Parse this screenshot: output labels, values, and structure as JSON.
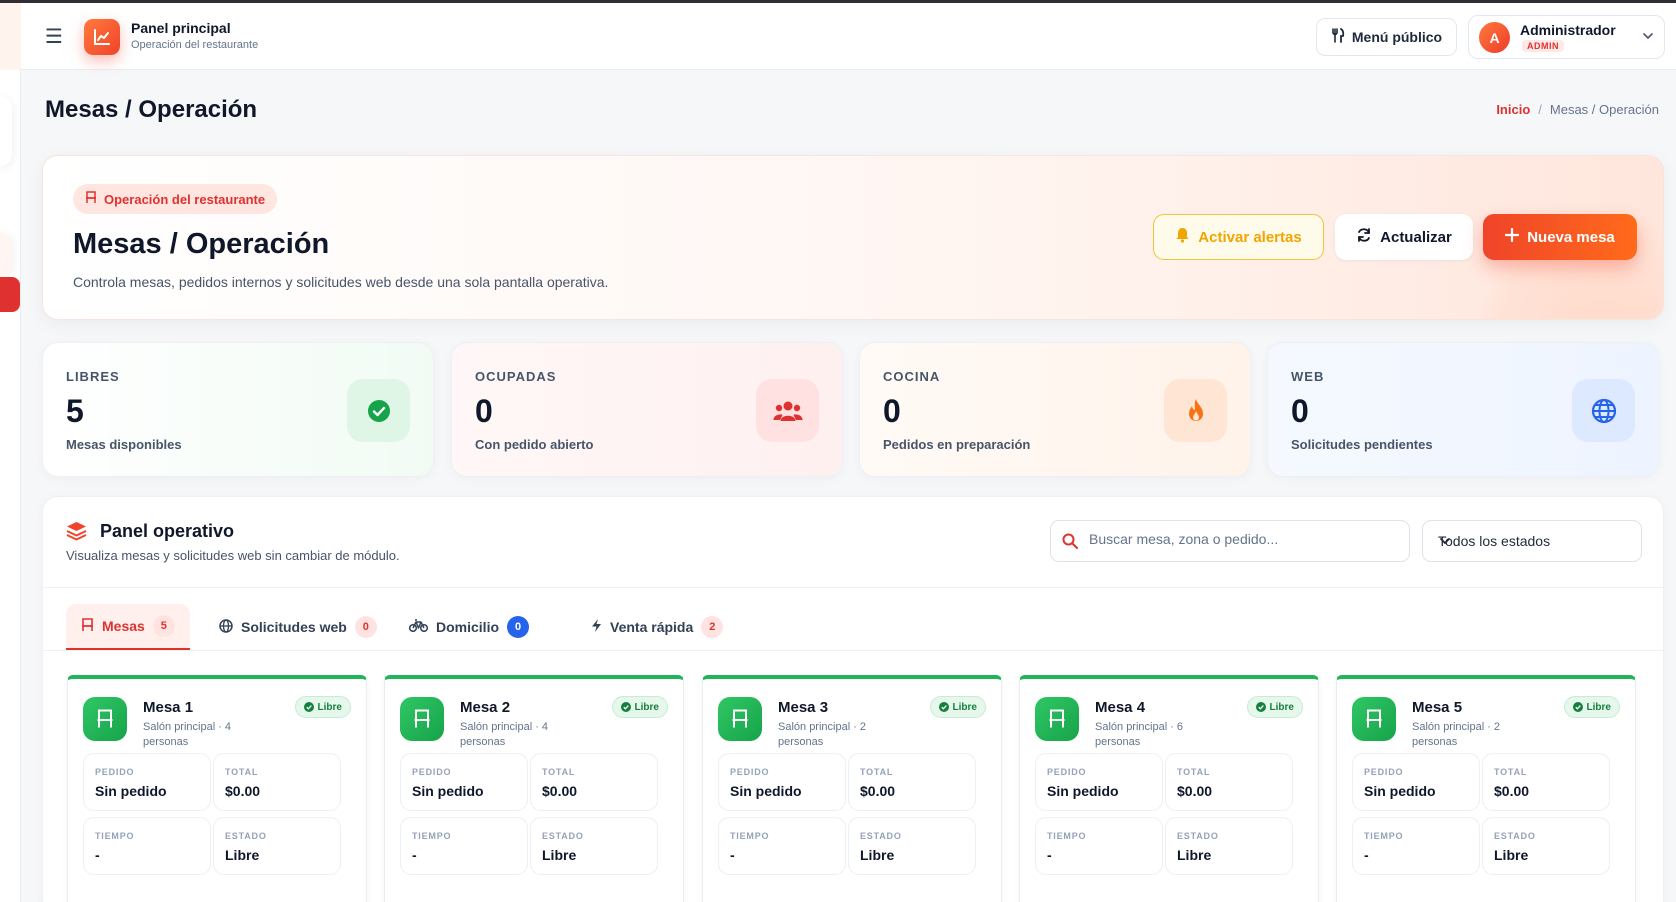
{
  "topbar": {
    "brand_title": "Panel principal",
    "brand_subtitle": "Operación del restaurante",
    "public_menu_label": "Menú público",
    "user_initial": "A",
    "user_name": "Administrador",
    "user_role": "ADMIN"
  },
  "page": {
    "title": "Mesas / Operación",
    "breadcrumb_home": "Inicio",
    "breadcrumb_sep": "/",
    "breadcrumb_current": "Mesas / Operación"
  },
  "hero": {
    "tag": "Operación del restaurante",
    "title": "Mesas / Operación",
    "subtitle": "Controla mesas, pedidos internos y solicitudes web desde una sola pantalla operativa.",
    "btn_alerts": "Activar alertas",
    "btn_refresh": "Actualizar",
    "btn_new": "Nueva mesa"
  },
  "stats": [
    {
      "label": "LIBRES",
      "value": "5",
      "desc": "Mesas disponibles",
      "icon": "check-circle-icon",
      "color": "#16a34a"
    },
    {
      "label": "OCUPADAS",
      "value": "0",
      "desc": "Con pedido abierto",
      "icon": "users-icon",
      "color": "#e03131"
    },
    {
      "label": "COCINA",
      "value": "0",
      "desc": "Pedidos en preparación",
      "icon": "fire-icon",
      "color": "#f97316"
    },
    {
      "label": "WEB",
      "value": "0",
      "desc": "Solicitudes pendientes",
      "icon": "globe-icon",
      "color": "#2563eb"
    }
  ],
  "panel": {
    "title": "Panel operativo",
    "subtitle": "Visualiza mesas y solicitudes web sin cambiar de módulo.",
    "search_placeholder": "Buscar mesa, zona o pedido...",
    "filter_value": "Todos los estados",
    "tabs": [
      {
        "label": "Mesas",
        "count": "5"
      },
      {
        "label": "Solicitudes web",
        "count": "0"
      },
      {
        "label": "Domicilio",
        "count": "0"
      },
      {
        "label": "Venta rápida",
        "count": "2"
      }
    ]
  },
  "card_labels": {
    "pedido": "PEDIDO",
    "total": "TOTAL",
    "tiempo": "TIEMPO",
    "estado": "ESTADO"
  },
  "tables": [
    {
      "name": "Mesa 1",
      "zone": "Salón principal · 4 personas",
      "badge": "Libre",
      "pedido": "Sin pedido",
      "total": "$0.00",
      "tiempo": "-",
      "estado": "Libre"
    },
    {
      "name": "Mesa 2",
      "zone": "Salón principal · 4 personas",
      "badge": "Libre",
      "pedido": "Sin pedido",
      "total": "$0.00",
      "tiempo": "-",
      "estado": "Libre"
    },
    {
      "name": "Mesa 3",
      "zone": "Salón principal · 2 personas",
      "badge": "Libre",
      "pedido": "Sin pedido",
      "total": "$0.00",
      "tiempo": "-",
      "estado": "Libre"
    },
    {
      "name": "Mesa 4",
      "zone": "Salón principal · 6 personas",
      "badge": "Libre",
      "pedido": "Sin pedido",
      "total": "$0.00",
      "tiempo": "-",
      "estado": "Libre"
    },
    {
      "name": "Mesa 5",
      "zone": "Salón principal · 2 personas",
      "badge": "Libre",
      "pedido": "Sin pedido",
      "total": "$0.00",
      "tiempo": "-",
      "estado": "Libre"
    }
  ]
}
